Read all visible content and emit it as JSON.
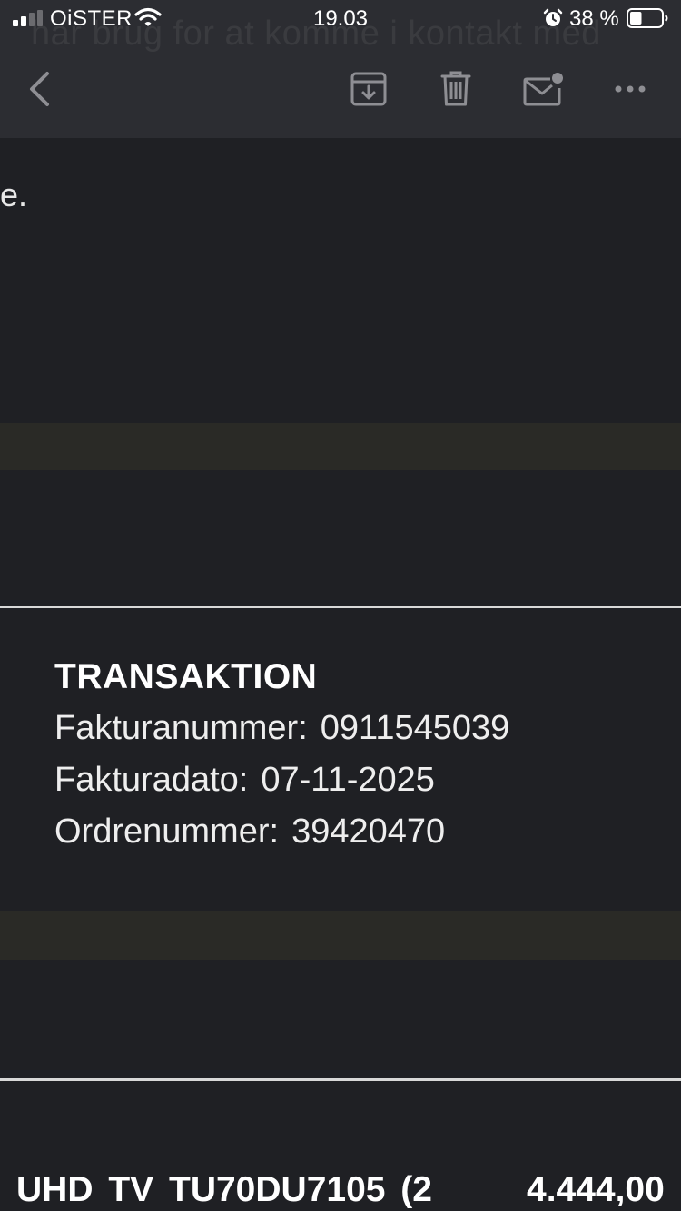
{
  "status_bar": {
    "carrier": "OiSTER",
    "time": "19.03",
    "battery_percent": "38 %",
    "signal_bars": 2,
    "battery_level": 0.38,
    "icons": [
      "signal-icon",
      "wifi-icon",
      "alarm-icon",
      "battery-icon"
    ]
  },
  "background_bleed_text": "har brug for at komme i kontakt med",
  "toolbar": {
    "icons": [
      "chevron-left-icon",
      "archive-icon",
      "trash-icon",
      "mail-unread-icon",
      "more-icon"
    ]
  },
  "email": {
    "text_fragment": "e.",
    "transaction": {
      "heading": "TRANSAKTION",
      "invoice_number_label": "Fakturanummer:",
      "invoice_number": "0911545039",
      "invoice_date_label": "Fakturadato:",
      "invoice_date": "07-11-2025",
      "order_number_label": "Ordrenummer:",
      "order_number": "39420470"
    },
    "line_item": {
      "product": "UHD TV TU70DU7105 (2",
      "price": "4.444,00"
    }
  },
  "colors": {
    "background": "#1f2024",
    "header": "#2c2d32",
    "icon": "#8e8e93",
    "band": "#2a2a26",
    "divider": "#d8d8d8"
  }
}
